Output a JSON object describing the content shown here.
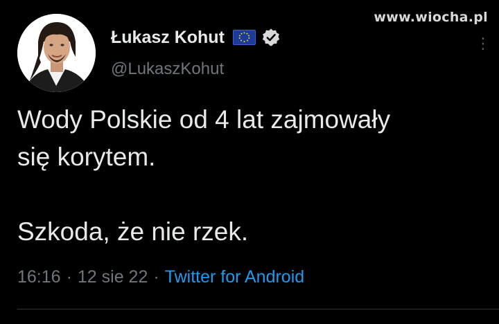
{
  "watermark": "www.wiocha.pl",
  "author": {
    "display_name": "Łukasz Kohut",
    "handle": "@LukaszKohut"
  },
  "tweet": {
    "line1": "Wody Polskie od 4 lat zajmowały",
    "line2": "się korytem.",
    "line3": "Szkoda, że nie rzek."
  },
  "meta": {
    "time": "16:16",
    "separator": "·",
    "date": "12 sie 22",
    "source": "Twitter for Android"
  },
  "colors": {
    "background": "#000000",
    "text": "#e7e9ea",
    "secondary": "#71767b",
    "link": "#1d9bf0",
    "eu_flag": "#1b3a9a"
  },
  "icons": [
    "eu-flag-icon",
    "verified-badge-icon",
    "more-icon"
  ]
}
